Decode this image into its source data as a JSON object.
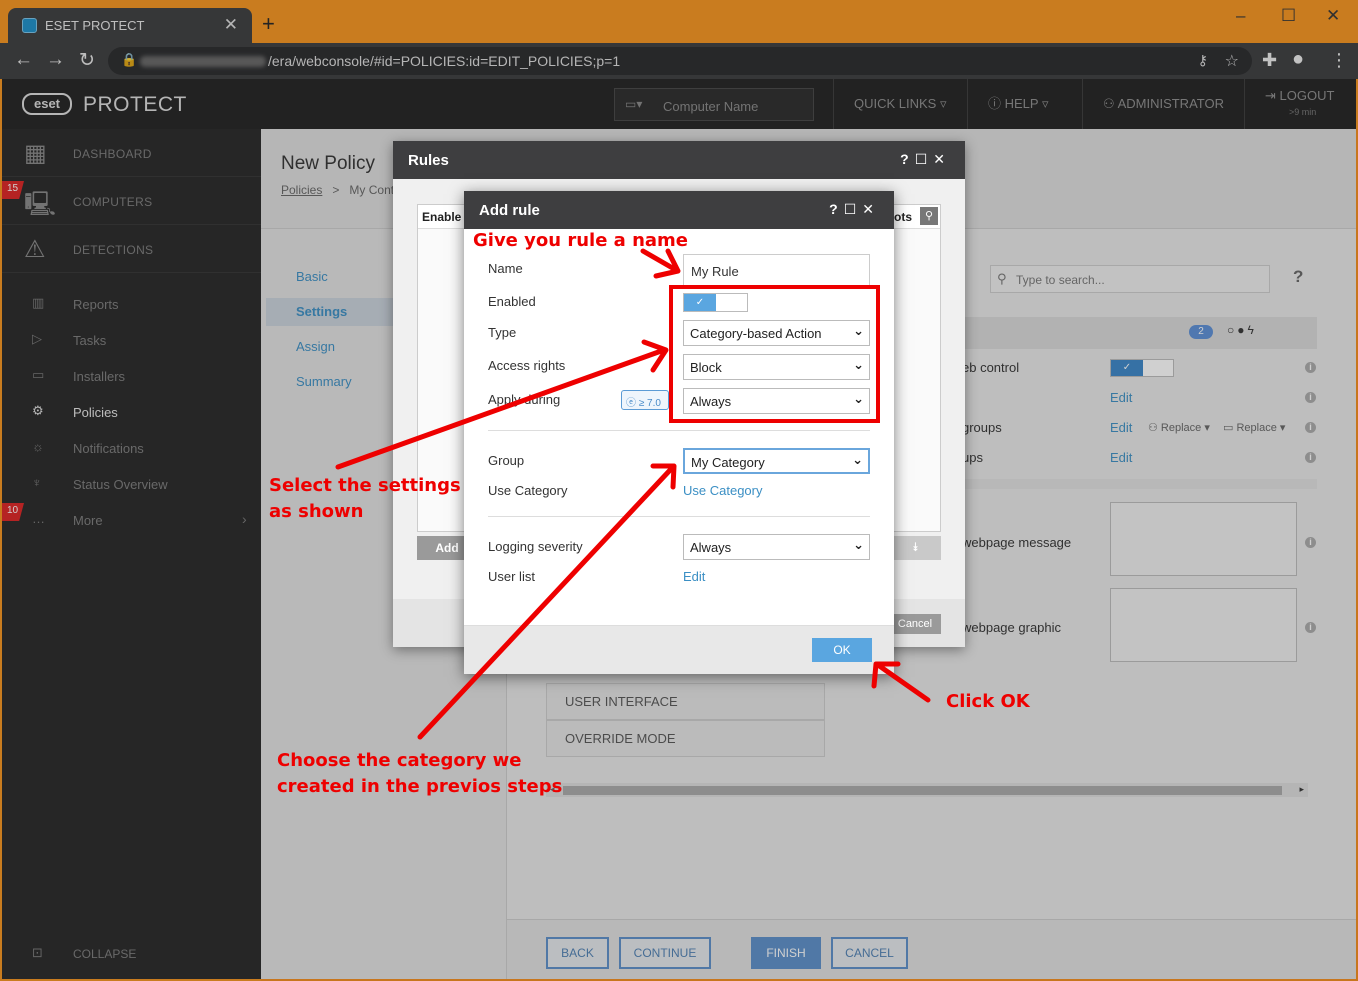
{
  "browser": {
    "tab_title": "ESET PROTECT",
    "new_tab": "+",
    "url": "/era/webconsole/#id=POLICIES:id=EDIT_POLICIES;p=1",
    "win_minimize": "–",
    "win_maximize": "☐",
    "win_close": "✕"
  },
  "header": {
    "logo": "eset",
    "brand": "PROTECT",
    "search_placeholder": "Computer Name",
    "quick_links": "QUICK LINKS",
    "help": "HELP",
    "admin": "ADMINISTRATOR",
    "logout": "LOGOUT",
    "logout_time": ">9 min"
  },
  "sidebar": {
    "dashboard": "DASHBOARD",
    "computers": "COMPUTERS",
    "computers_badge": "15",
    "detections": "DETECTIONS",
    "reports": "Reports",
    "tasks": "Tasks",
    "installers": "Installers",
    "policies": "Policies",
    "notifications": "Notifications",
    "status": "Status Overview",
    "more": "More",
    "more_badge": "10",
    "collapse": "COLLAPSE"
  },
  "page": {
    "title": "New Policy",
    "crumb_1": "Policies",
    "crumb_sep": ">",
    "crumb_2": "My Conte",
    "steps": [
      "Basic",
      "Settings",
      "Assign",
      "Summary"
    ],
    "search_placeholder": "Type to search...",
    "help_icon": "?",
    "count_badge": "2",
    "rows": {
      "web_control": "eb control",
      "edit1": "Edit",
      "groups": "groups",
      "edit2": "Edit",
      "replace1": "Replace",
      "replace2": "Replace",
      "ups": "ups",
      "edit3": "Edit",
      "webpage_message": "webpage message",
      "webpage_graphic": "webpage graphic"
    },
    "sections": [
      "USER INTERFACE",
      "OVERRIDE MODE"
    ],
    "footer": {
      "back": "BACK",
      "continue": "CONTINUE",
      "finish": "FINISH",
      "cancel": "CANCEL"
    }
  },
  "rules_dialog": {
    "title": "Rules",
    "col_enabled": "Enable",
    "col_right": "ots",
    "add": "Add",
    "cancel": "Cancel"
  },
  "add_rule": {
    "title": "Add rule",
    "name_label": "Name",
    "name_value": "My Rule",
    "enabled_label": "Enabled",
    "type_label": "Type",
    "type_value": "Category-based Action",
    "access_label": "Access rights",
    "access_value": "Block",
    "apply_label": "Apply during",
    "version_badge": "≥ 7.0",
    "apply_value": "Always",
    "group_label": "Group",
    "group_value": "My Category",
    "use_category_label": "Use Category",
    "use_category_link": "Use Category",
    "logging_label": "Logging severity",
    "logging_value": "Always",
    "user_list_label": "User list",
    "user_list_link": "Edit",
    "ok": "OK"
  },
  "annotations": {
    "name_hint": "Give you rule a name",
    "settings_hint_1": "Select the settings",
    "settings_hint_2": "as shown",
    "category_hint_1": "Choose the category we",
    "category_hint_2": "created in the previos steps",
    "ok_hint": "Click OK",
    "color": "#e00000"
  }
}
